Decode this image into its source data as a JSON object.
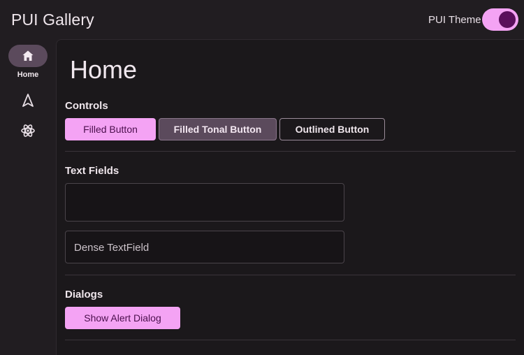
{
  "app": {
    "title": "PUI Gallery"
  },
  "header": {
    "theme_label": "PUI Theme",
    "theme_toggle_on": true
  },
  "rail": {
    "items": [
      {
        "icon": "home-icon",
        "label": "Home",
        "active": true
      },
      {
        "icon": "navigation-arrow-icon",
        "label": "",
        "active": false
      },
      {
        "icon": "atom-icon",
        "label": "",
        "active": false
      }
    ]
  },
  "main": {
    "page_title": "Home",
    "controls": {
      "title": "Controls",
      "filled_label": "Filled Button",
      "tonal_label": "Filled Tonal Button",
      "outlined_label": "Outlined Button"
    },
    "text_fields": {
      "title": "Text Fields",
      "field1_value": "",
      "field2_placeholder": "Dense TextField"
    },
    "dialogs": {
      "title": "Dialogs",
      "show_alert_label": "Show Alert Dialog"
    }
  },
  "colors": {
    "primary": "#f4a3f4",
    "on_primary": "#4a0f4c",
    "tonal": "#5b4a5c",
    "background": "#211d21",
    "surface": "#1b181b"
  }
}
